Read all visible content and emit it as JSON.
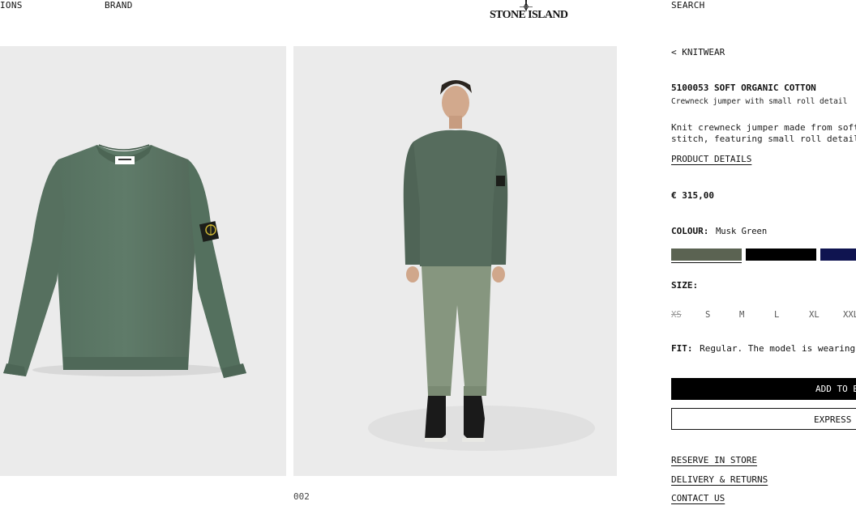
{
  "header": {
    "nav_left_1": "IONS",
    "nav_left_2": "BRAND",
    "logo_text": "STONE ISLAND",
    "search_label": "SEARCH"
  },
  "gallery": {
    "image_counter": "002"
  },
  "product": {
    "breadcrumb": "< KNITWEAR",
    "title": "5100053 SOFT ORGANIC COTTON",
    "subtitle": "Crewneck jumper with small roll detail",
    "description_line1": "Knit crewneck jumper made from soft",
    "description_line2": "stitch, featuring small roll detail",
    "details_link": "PRODUCT DETAILS",
    "price": "€ 315,00",
    "colour_label": "COLOUR:",
    "colour_value": "Musk Green",
    "swatches": [
      {
        "name": "Musk Green",
        "color": "#5b6352",
        "selected": true
      },
      {
        "name": "Black",
        "color": "#000000",
        "selected": false
      },
      {
        "name": "Navy",
        "color": "#0f1450",
        "selected": false
      }
    ],
    "size_label": "SIZE:",
    "sizes": [
      {
        "label": "XS",
        "available": false
      },
      {
        "label": "S",
        "available": true
      },
      {
        "label": "M",
        "available": true
      },
      {
        "label": "L",
        "available": true
      },
      {
        "label": "XL",
        "available": true
      },
      {
        "label": "XXL",
        "available": true
      }
    ],
    "fit_label": "FIT:",
    "fit_value": "Regular. The model is wearing",
    "add_to_bag_button": "ADD TO B",
    "express_button": "EXPRESS",
    "links": {
      "reserve": "RESERVE IN STORE",
      "delivery": "DELIVERY & RETURNS",
      "contact": "CONTACT US"
    }
  }
}
